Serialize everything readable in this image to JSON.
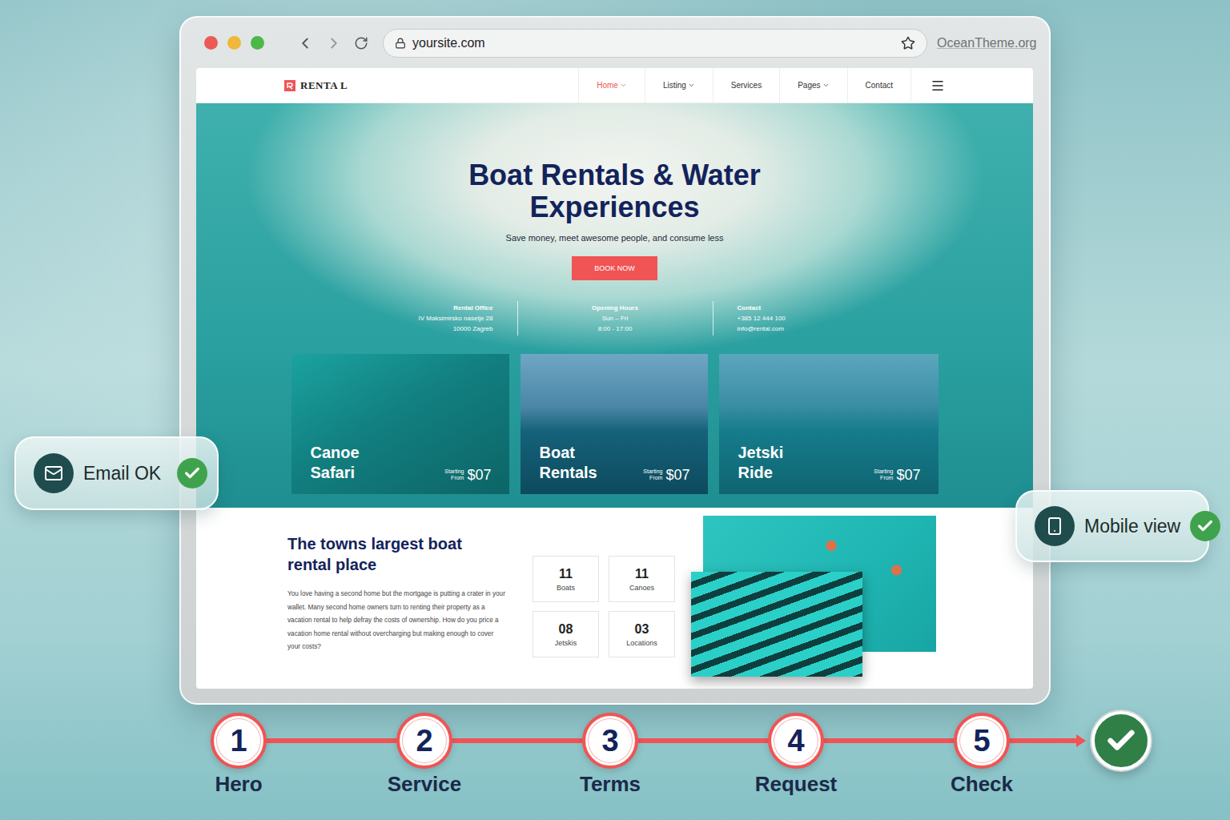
{
  "browser": {
    "url": "yoursite.com",
    "watermark": "OceanTheme.org"
  },
  "site": {
    "logo": "RENTA L",
    "nav": [
      {
        "label": "Home",
        "selected": true,
        "dropdown": true
      },
      {
        "label": "Listing",
        "selected": false,
        "dropdown": true
      },
      {
        "label": "Services",
        "selected": false,
        "dropdown": false
      },
      {
        "label": "Pages",
        "selected": false,
        "dropdown": true
      },
      {
        "label": "Contact",
        "selected": false,
        "dropdown": false
      }
    ],
    "hero": {
      "title_lines": [
        "Boat Rentals & Water",
        "Experiences"
      ],
      "subtitle": "Save money, meet awesome people, and consume less",
      "button": "BOOK NOW",
      "info": [
        {
          "title": "Rental Office",
          "lines": [
            "IV Maksimirsko naselje 28",
            "10000 Zagreb"
          ]
        },
        {
          "title": "Opening Hours",
          "lines": [
            "Sun – Fri",
            "8:00 - 17:00"
          ]
        },
        {
          "title": "Contact",
          "lines": [
            "+385 12 444 100",
            "info@rental.com"
          ]
        }
      ],
      "cards": [
        {
          "title_lines": [
            "Canoe",
            "Safari"
          ],
          "price_label": [
            "Starting",
            "From"
          ],
          "price": "$07"
        },
        {
          "title_lines": [
            "Boat",
            "Rentals"
          ],
          "price_label": [
            "Starting",
            "From"
          ],
          "price": "$07"
        },
        {
          "title_lines": [
            "Jetski",
            "Ride"
          ],
          "price_label": [
            "Starting",
            "From"
          ],
          "price": "$07"
        }
      ]
    },
    "about": {
      "heading": "The towns largest boat rental place",
      "paragraph": "You love having a second home but the mortgage is putting a crater in your wallet. Many second home owners turn to renting their property as a vacation rental to help defray the costs of ownership. How do you price a vacation home rental without overcharging but making enough to cover your costs?",
      "stats": [
        {
          "value": "11",
          "label": "Boats"
        },
        {
          "value": "11",
          "label": "Canoes"
        },
        {
          "value": "08",
          "label": "Jetskis"
        },
        {
          "value": "03",
          "label": "Locations"
        }
      ]
    }
  },
  "badges": [
    {
      "label": "Email OK",
      "icon": "mail",
      "checked": true
    },
    {
      "label": "Mobile view",
      "icon": "phone",
      "checked": true
    }
  ],
  "steps": [
    {
      "number": "1",
      "label": "Hero"
    },
    {
      "number": "2",
      "label": "Service"
    },
    {
      "number": "3",
      "label": "Terms"
    },
    {
      "number": "4",
      "label": "Request"
    },
    {
      "number": "5",
      "label": "Check"
    }
  ],
  "finish": {
    "done": true
  }
}
